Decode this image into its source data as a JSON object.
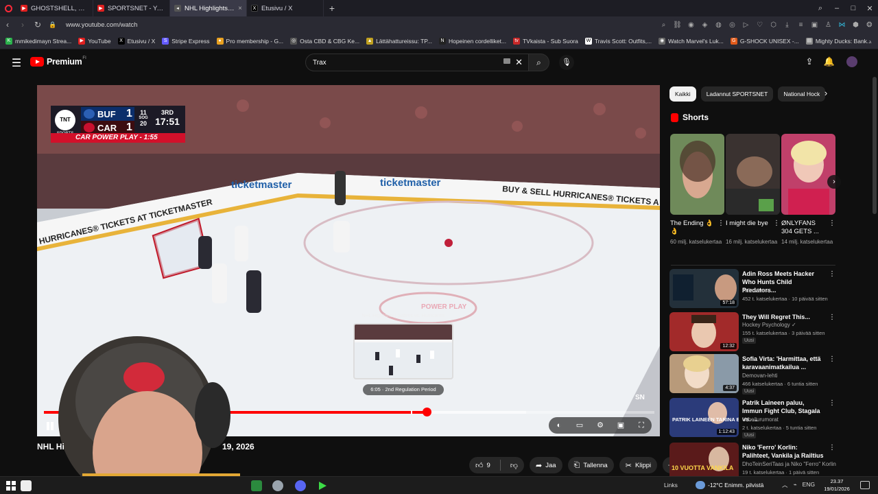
{
  "browser": {
    "tabs": [
      {
        "label": "GHOSTSHELL, Mannequin",
        "color": "#e02020",
        "active": false
      },
      {
        "label": "SPORTSNET - YouTube",
        "color": "#e02020",
        "active": false
      },
      {
        "label": "NHL Highlights | Sab",
        "color": "#e02020",
        "active": true
      },
      {
        "label": "Etusivu / X",
        "color": "#000000",
        "active": false
      }
    ],
    "url": "www.youtube.com/watch",
    "bookmarks": [
      {
        "label": "mmikedimayn Strea...",
        "color": "#2bb24c"
      },
      {
        "label": "YouTube",
        "color": "#e02020"
      },
      {
        "label": "Etusivu / X",
        "color": "#000000"
      },
      {
        "label": "Stripe Express",
        "color": "#635bff"
      },
      {
        "label": "Pro membership - G...",
        "color": "#e8a020"
      },
      {
        "label": "Osta CBD & CBG Ke...",
        "color": "#555555"
      },
      {
        "label": "Lättähattureissu: TP...",
        "color": "#c0a020"
      },
      {
        "label": "Hopeinen cordelliket...",
        "color": "#222222"
      },
      {
        "label": "TVkaista - Sub Suora",
        "color": "#c82828"
      },
      {
        "label": "Travis Scott: Outfits,...",
        "color": "#ffffff"
      },
      {
        "label": "Watch Marvel's Luk...",
        "color": "#666666"
      },
      {
        "label": "G-SHOCK UNISEX -...",
        "color": "#e05a1a"
      },
      {
        "label": "Mighty Ducks: Bank...",
        "color": "#888888"
      }
    ]
  },
  "header": {
    "logo_text": "Premium",
    "logo_region": "FI",
    "search_value": "Trax"
  },
  "player": {
    "scorebug": {
      "network": "TNT",
      "network_sub": "SPORTS",
      "away": "BUF",
      "away_score": "1",
      "away_sog": "11",
      "home": "CAR",
      "home_score": "1",
      "home_sog": "20",
      "sog_label": "SOG",
      "period": "3RD",
      "clock": "17:51",
      "situation": "CAR POWER PLAY - 1:55"
    },
    "board_ads": [
      "ticketmaster",
      "ticketmaster",
      "BUY & SELL HURRICANES® TICKETS A",
      "HURRICANES® TICKETS AT TICKETMASTER"
    ],
    "faceoff_text": "POWER PLAY",
    "preview_title": "NHL Highlights | Sabres vs. Hurricanes",
    "preview_time": "6:05 · 2nd Regulation Period",
    "progress": {
      "played": 0.627,
      "hover": 0.601,
      "loaded": 0.79
    },
    "network_bug": "SN"
  },
  "video": {
    "title_visible": "NHL Hi",
    "title_date": "19, 2026",
    "likes": "9",
    "share_label": "Jaa",
    "save_label": "Tallenna",
    "clip_label": "Klippi"
  },
  "sidebar": {
    "chips": [
      "Kaikki",
      "Ladannut SPORTSNET",
      "National Hock"
    ],
    "shorts_heading": "Shorts",
    "shorts": [
      {
        "title": "The Ending 👌👌",
        "views": "60 milj. katselukertaa",
        "tint": "#6f8a5a"
      },
      {
        "title": "I might die bye",
        "views": "16 milj. katselukertaa",
        "tint": "#3a3230"
      },
      {
        "title": "ØNLYFANS 304 GETS ...",
        "views": "14 milj. katselukertaa",
        "tint": "#c0406a"
      }
    ],
    "recommendations": [
      {
        "title": "Adin Ross Meets Hacker Who Hunts Child Predators...",
        "channel": "Adin Live ✓",
        "meta": "452 t. katselukertaa · 10 päivää sitten",
        "duration": "57:18",
        "new": false,
        "tint": "#23303a"
      },
      {
        "title": "They Will Regret This...",
        "channel": "Hockey Psychology ✓",
        "meta": "155 t. katselukertaa · 3 päivää sitten",
        "duration": "12:32",
        "new": true,
        "tint": "#a22a2a"
      },
      {
        "title": "Sofia Virta: 'Harmittaa, että karavaanimatkailua ...",
        "channel": "Demovan-lehti",
        "meta": "466 katselukertaa · 6 tuntia sitten",
        "duration": "4:37",
        "new": true,
        "tint": "#b89a7a"
      },
      {
        "title": "Patrik Laineen paluu, Immun Fight Club, Stagala vs. ...",
        "channel": "Urheilurumorat",
        "meta": "2 t. katselukertaa · 5 tuntia sitten",
        "duration": "1:12:43",
        "new": true,
        "tint": "#2b3b7a"
      },
      {
        "title": "Niko 'Ferro' Korlin: Palihteet, Vankila ja Railtius",
        "channel": "DhoTeinSeriTaas ja Niko \"Ferro\" Korlin",
        "meta": "19 t. katselukertaa · 1 päivä sitten",
        "duration": "",
        "new": false,
        "tint": "#5a1a1a"
      }
    ],
    "new_label": "Uusi",
    "thumb_texts": [
      "PATRIK LAINEEN TARINA EI OLE OHI",
      "10 VUOTTA VANKILA"
    ]
  },
  "taskbar": {
    "links": "Links",
    "weather": "-12°C  Enimm. pilvistä",
    "lang": "ENG",
    "time": "23.37",
    "date": "19/01/2026"
  }
}
